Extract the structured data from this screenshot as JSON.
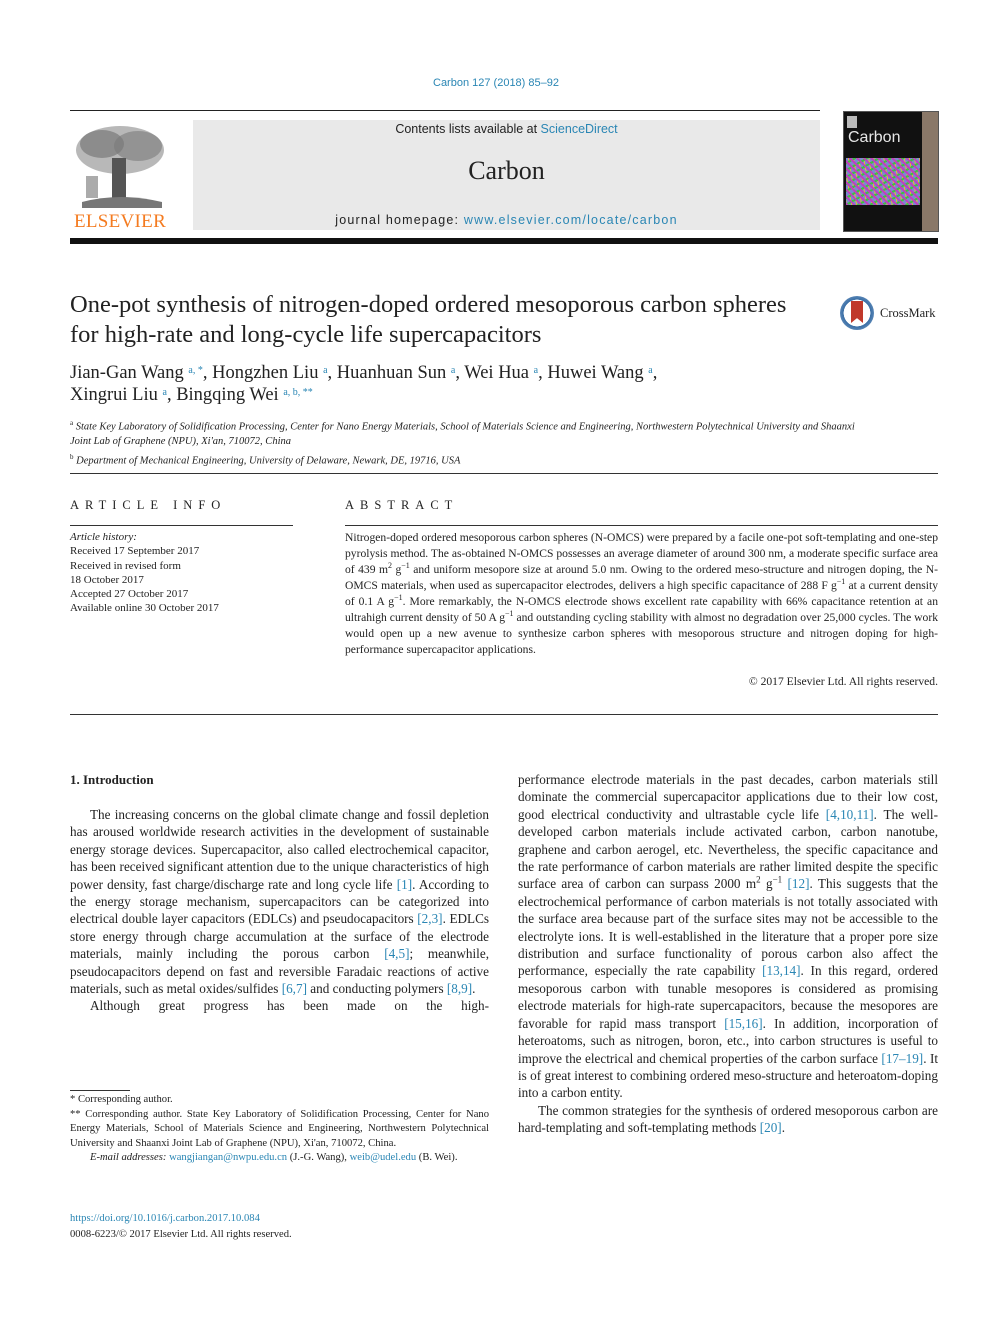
{
  "header": {
    "citation": "Carbon 127 (2018) 85–92",
    "contents_prefix": "Contents lists available at ",
    "contents_link": "ScienceDirect",
    "journal_name": "Carbon",
    "homepage_prefix": "journal homepage: ",
    "homepage_link": "www.elsevier.com/locate/carbon",
    "publisher_logo": "ELSEVIER",
    "cover_title": "Carbon",
    "crossmark_label": "CrossMark"
  },
  "article": {
    "title": "One-pot synthesis of nitrogen-doped ordered mesoporous carbon spheres for high-rate and long-cycle life supercapacitors",
    "authors": [
      {
        "name": "Jian-Gan Wang",
        "sup": "a, *"
      },
      {
        "name": "Hongzhen Liu",
        "sup": "a"
      },
      {
        "name": "Huanhuan Sun",
        "sup": "a"
      },
      {
        "name": "Wei Hua",
        "sup": "a"
      },
      {
        "name": "Huwei Wang",
        "sup": "a"
      },
      {
        "name": "Xingrui Liu",
        "sup": "a"
      },
      {
        "name": "Bingqing Wei",
        "sup": "a, b, **"
      }
    ],
    "affiliations": [
      {
        "mark": "a",
        "text": "State Key Laboratory of Solidification Processing, Center for Nano Energy Materials, School of Materials Science and Engineering, Northwestern Polytechnical University and Shaanxi Joint Lab of Graphene (NPU), Xi'an, 710072, China"
      },
      {
        "mark": "b",
        "text": "Department of Mechanical Engineering, University of Delaware, Newark, DE, 19716, USA"
      }
    ]
  },
  "article_info": {
    "heading": "ARTICLE INFO",
    "history_label": "Article history:",
    "history": [
      "Received 17 September 2017",
      "Received in revised form",
      "18 October 2017",
      "Accepted 27 October 2017",
      "Available online 30 October 2017"
    ]
  },
  "abstract": {
    "heading": "ABSTRACT",
    "p1": "Nitrogen-doped ordered mesoporous carbon spheres (N-OMCS) were prepared by a facile one-pot soft-templating and one-step pyrolysis method. The as-obtained N-OMCS possesses an average diameter of around 300 nm, a moderate specific surface area of 439 m",
    "p2": " and uniform mesopore size at around 5.0 nm. Owing to the ordered meso-structure and nitrogen doping, the N-OMCS materials, when used as supercapacitor electrodes, delivers a high specific capacitance of 288 F g",
    "p3": " at a current density of 0.1 A g",
    "p4": ". More remarkably, the N-OMCS electrode shows excellent rate capability with 66% capacitance retention at an ultrahigh current density of 50 A g",
    "p5": " and outstanding cycling stability with almost no degradation over 25,000 cycles. The work would open up a new avenue to synthesize carbon spheres with mesoporous structure and nitrogen doping for high-performance supercapacitor applications.",
    "unit_g": " g",
    "sup2": "2",
    "supm1": "−1",
    "copyright": "© 2017 Elsevier Ltd. All rights reserved."
  },
  "intro": {
    "heading": "1.  Introduction",
    "left_p1": [
      "The increasing concerns on the global climate change and fossil depletion has aroused worldwide research activities in the development of sustainable energy storage devices. Supercapacitor, also called electrochemical capacitor, has been received significant attention due to the unique characteristics of high power density, fast charge/discharge rate and long cycle life ",
      "[1]",
      ". According to the energy storage mechanism, supercapacitors can be categorized into electrical double layer capacitors (EDLCs) and pseudocapacitors ",
      "[2,3]",
      ". EDLCs store energy through charge accumulation at the surface of the electrode materials, mainly including the porous carbon ",
      "[4,5]",
      "; meanwhile, pseudocapacitors depend on fast and reversible Faradaic reactions of active materials, such as metal oxides/sulfides ",
      "[6,7]",
      " and conducting polymers ",
      "[8,9]",
      "."
    ],
    "left_p2": "Although great progress has been made on the high-",
    "right_p1": [
      "performance electrode materials in the past decades, carbon materials still dominate the commercial supercapacitor applications due to their low cost, good electrical conductivity and ultrastable cycle life ",
      "[4,10,11]",
      ". The well-developed carbon materials include activated carbon, carbon nanotube, graphene and carbon aerogel, etc. Nevertheless, the specific capacitance and the rate performance of carbon materials are rather limited despite the specific surface area of carbon can surpass 2000 m",
      "2",
      " g",
      "−1",
      " ",
      "[12]",
      ". This suggests that the electrochemical performance of carbon materials is not totally associated with the surface area because part of the surface sites may not be accessible to the electrolyte ions. It is well-established in the literature that a proper pore size distribution and surface functionality of porous carbon also affect the performance, especially the rate capability ",
      "[13,14]",
      ". In this regard, ordered mesoporous carbon with tunable mesopores is considered as promising electrode materials for high-rate supercapacitors, because the mesopores are favorable for rapid mass transport ",
      "[15,16]",
      ". In addition, incorporation of heteroatoms, such as nitrogen, boron, etc., into carbon structures is useful to improve the electrical and chemical properties of the carbon surface ",
      "[17–19]",
      ". It is of great interest to combining ordered meso-structure and heteroatom-doping into a carbon entity."
    ],
    "right_p2": [
      "The common strategies for the synthesis of ordered mesoporous carbon are hard-templating and soft-templating methods ",
      "[20]",
      "."
    ]
  },
  "footnotes": {
    "fn1": " * Corresponding author.",
    "fn2": " ** Corresponding author. State Key Laboratory of Solidification Processing, Center for Nano Energy Materials, School of Materials Science and Engineering, Northwestern Polytechnical University and Shaanxi Joint Lab of Graphene (NPU), Xi'an, 710072, China.",
    "email_label": "E-mail addresses:",
    "email1": "wangjiangan@nwpu.edu.cn",
    "email1_who": " (J.-G. Wang), ",
    "email2": "weib@udel.edu",
    "email2_who": " (B. Wei).",
    "doi": "https://doi.org/10.1016/j.carbon.2017.10.084",
    "issn": "0008-6223/© 2017 Elsevier Ltd. All rights reserved."
  }
}
